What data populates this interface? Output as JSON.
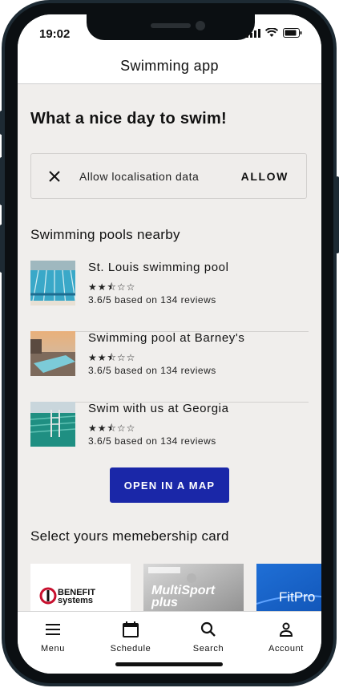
{
  "status_bar": {
    "time": "19:02"
  },
  "app_bar": {
    "title": "Swimming app"
  },
  "greeting": "What a nice day to swim!",
  "location_banner": {
    "message": "Allow localisation data",
    "action_label": "ALLOW",
    "close_icon": "close-icon"
  },
  "pools_section": {
    "title": "Swimming pools nearby",
    "pools": [
      {
        "name": "St. Louis swimming pool",
        "rating": 2.5,
        "stars": "★★⯪☆☆",
        "reviews": "3.6/5 based on 134 reviews"
      },
      {
        "name": "Swimming pool at Barney's",
        "rating": 2.5,
        "stars": "★★⯪☆☆",
        "reviews": "3.6/5 based on 134 reviews"
      },
      {
        "name": "Swim with us at Georgia",
        "rating": 2.5,
        "stars": "★★⯪☆☆",
        "reviews": "3.6/5 based on 134 reviews"
      }
    ]
  },
  "map_button": {
    "label": "OPEN IN A MAP"
  },
  "membership_section": {
    "title": "Select yours memebership card",
    "cards": [
      {
        "name": "BENEFIT systems"
      },
      {
        "name": "MultiSport plus"
      },
      {
        "name": "FitPro"
      }
    ]
  },
  "bottom_nav": {
    "items": [
      {
        "label": "Menu",
        "icon": "menu-icon"
      },
      {
        "label": "Schedule",
        "icon": "calendar-icon"
      },
      {
        "label": "Search",
        "icon": "search-icon"
      },
      {
        "label": "Account",
        "icon": "person-icon"
      }
    ]
  },
  "colors": {
    "primary_button": "#1a27a8",
    "screen_background": "#f0eeec",
    "appbar_background": "#ffffff"
  }
}
